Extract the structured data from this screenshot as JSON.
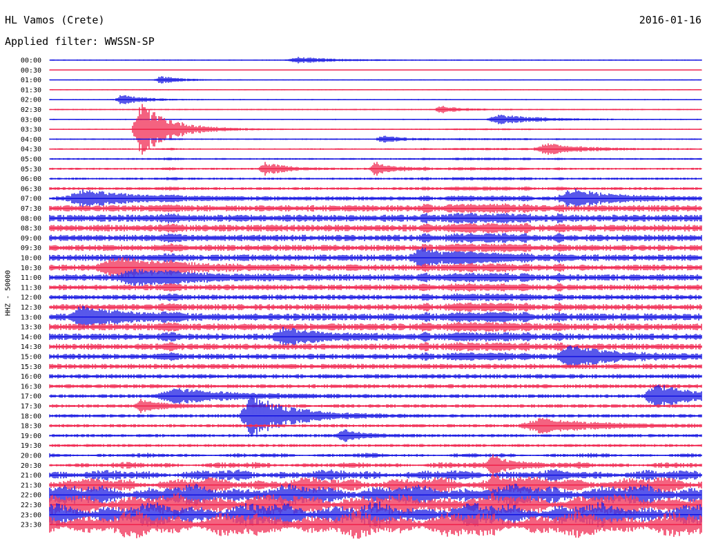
{
  "header": {
    "station": "HL Vamos (Crete)",
    "date": "2016-01-16",
    "filter_text": "Applied filter: WWSSN-SP"
  },
  "channel_label": "HHZ - 50000",
  "colors": {
    "even_row": "#1010e0",
    "odd_row": "#f0204a",
    "text": "#000000"
  },
  "chart_data": {
    "type": "line",
    "title": "HL Vamos (Crete)",
    "subtitle": "Applied filter: WWSSN-SP",
    "ylabel": "HHZ - 50000",
    "y_tick_labels": [
      "00:00",
      "00:30",
      "01:00",
      "01:30",
      "02:00",
      "02:30",
      "03:00",
      "03:30",
      "04:00",
      "04:30",
      "05:00",
      "05:30",
      "06:00",
      "06:30",
      "07:00",
      "07:30",
      "08:00",
      "08:30",
      "09:00",
      "09:30",
      "10:00",
      "10:30",
      "11:00",
      "11:30",
      "12:00",
      "12:30",
      "13:00",
      "13:30",
      "14:00",
      "14:30",
      "15:00",
      "15:30",
      "16:00",
      "16:30",
      "17:00",
      "17:30",
      "18:00",
      "18:30",
      "19:00",
      "19:30",
      "20:00",
      "20:30",
      "21:00",
      "21:30",
      "22:00",
      "22:30",
      "23:00",
      "23:30"
    ],
    "noise_level": [
      0.5,
      0.5,
      0.5,
      0.5,
      0.6,
      0.7,
      0.6,
      0.6,
      0.7,
      0.8,
      0.9,
      1.0,
      1.1,
      1.4,
      2.0,
      3.2,
      3.6,
      3.4,
      3.2,
      3.0,
      3.2,
      3.0,
      3.2,
      2.8,
      2.6,
      3.0,
      3.6,
      3.4,
      3.2,
      3.0,
      2.8,
      2.6,
      2.2,
      2.0,
      1.8,
      1.7,
      1.7,
      1.6,
      1.6,
      1.5,
      1.6,
      2.2,
      3.8,
      5.5,
      7.5,
      8.0,
      8.5,
      9.0
    ],
    "events": [
      {
        "row": 0,
        "x": 0.38,
        "amp": 3,
        "width": 0.02
      },
      {
        "row": 2,
        "x": 0.17,
        "amp": 4,
        "width": 0.01
      },
      {
        "row": 4,
        "x": 0.11,
        "amp": 6,
        "width": 0.01
      },
      {
        "row": 5,
        "x": 0.6,
        "amp": 4,
        "width": 0.01
      },
      {
        "row": 6,
        "x": 0.69,
        "amp": 5,
        "width": 0.02
      },
      {
        "row": 7,
        "x": 0.14,
        "amp": 28,
        "width": 0.015
      },
      {
        "row": 8,
        "x": 0.51,
        "amp": 4,
        "width": 0.01
      },
      {
        "row": 9,
        "x": 0.76,
        "amp": 6,
        "width": 0.02
      },
      {
        "row": 11,
        "x": 0.33,
        "amp": 7,
        "width": 0.01
      },
      {
        "row": 11,
        "x": 0.5,
        "amp": 7,
        "width": 0.01
      },
      {
        "row": 14,
        "x": 0.05,
        "amp": 8,
        "width": 0.03
      },
      {
        "row": 14,
        "x": 0.8,
        "amp": 10,
        "width": 0.02
      },
      {
        "row": 20,
        "x": 0.57,
        "amp": 8,
        "width": 0.02
      },
      {
        "row": 21,
        "x": 0.1,
        "amp": 10,
        "width": 0.03
      },
      {
        "row": 22,
        "x": 0.13,
        "amp": 8,
        "width": 0.03
      },
      {
        "row": 26,
        "x": 0.05,
        "amp": 10,
        "width": 0.02
      },
      {
        "row": 28,
        "x": 0.36,
        "amp": 8,
        "width": 0.02
      },
      {
        "row": 30,
        "x": 0.8,
        "amp": 12,
        "width": 0.02
      },
      {
        "row": 34,
        "x": 0.19,
        "amp": 8,
        "width": 0.03
      },
      {
        "row": 34,
        "x": 0.93,
        "amp": 12,
        "width": 0.02
      },
      {
        "row": 35,
        "x": 0.14,
        "amp": 7,
        "width": 0.01
      },
      {
        "row": 36,
        "x": 0.31,
        "amp": 22,
        "width": 0.02
      },
      {
        "row": 37,
        "x": 0.75,
        "amp": 7,
        "width": 0.03
      },
      {
        "row": 38,
        "x": 0.45,
        "amp": 6,
        "width": 0.01
      },
      {
        "row": 41,
        "x": 0.68,
        "amp": 12,
        "width": 0.01
      },
      {
        "row": 43,
        "x": 0.68,
        "amp": 10,
        "width": 0.01
      }
    ]
  }
}
